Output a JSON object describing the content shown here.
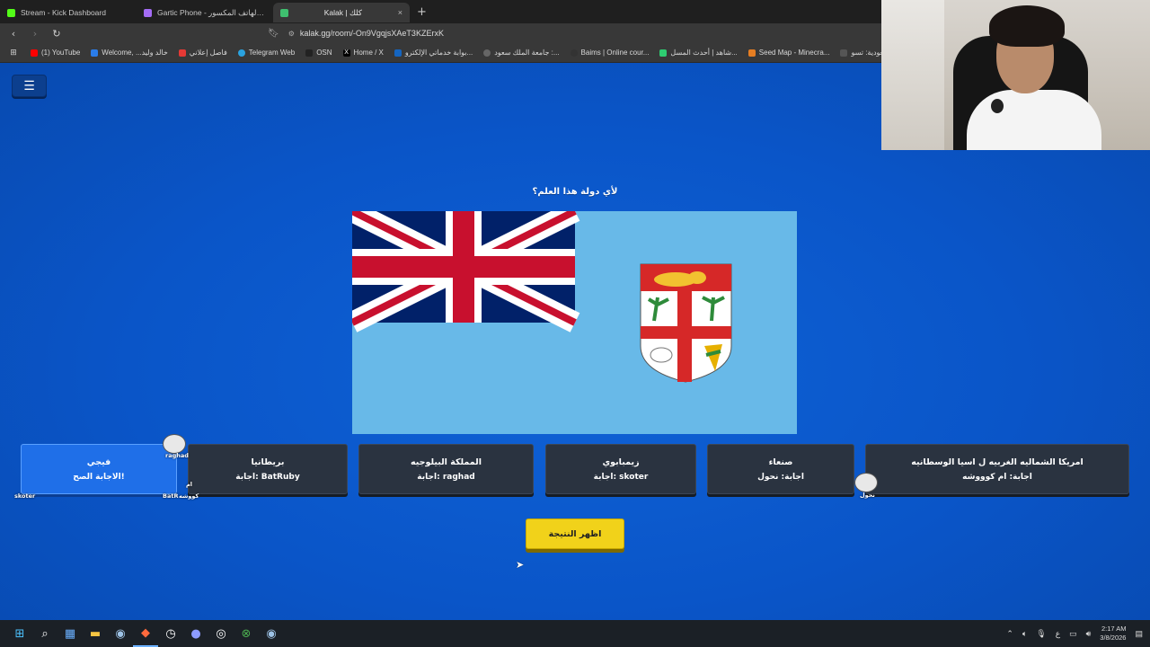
{
  "browser": {
    "tabs": [
      {
        "title": "Stream - Kick Dashboard",
        "icon": "kick-icon",
        "color": "#53fc18",
        "active": false
      },
      {
        "title": "Gartic Phone - لعبة الهاتف المكسور",
        "icon": "gartic-icon",
        "color": "#a46cf5",
        "active": false
      },
      {
        "title": "Kalak | كلك",
        "icon": "kalak-icon",
        "color": "#3fbf6f",
        "active": true
      }
    ],
    "new_tab": "+",
    "tab_close": "×",
    "url": "kalak.gg/room/-On9VgqjsXAeT3KZErxK",
    "bookmarks": [
      {
        "label": "(1) YouTube",
        "color": "#ff0000"
      },
      {
        "label": "Welcome, ...خالد وليد",
        "color": "#2b7de9"
      },
      {
        "label": "فاصل إعلاني",
        "color": "#e53935"
      },
      {
        "label": "Telegram Web",
        "color": "#2aa3e0"
      },
      {
        "label": "OSN",
        "color": "#222222"
      },
      {
        "label": "Home / X",
        "color": "#000000"
      },
      {
        "label": "بوابة خدماتي الإلكترو...",
        "color": "#1565c0"
      },
      {
        "label": "جامعة الملك سعود :...",
        "color": "#666666"
      },
      {
        "label": "Baims | Online cour...",
        "color": "#333333"
      },
      {
        "label": "شاهد | أحدث المسل...",
        "color": "#2ecc71"
      },
      {
        "label": "Seed Map - Minecra...",
        "color": "#e67e22"
      },
      {
        "label": "السعودية: تسو...",
        "color": "#555555"
      }
    ]
  },
  "game": {
    "question": "لأي دولة هذا العلم؟",
    "flag_name": "Fiji",
    "answers": [
      {
        "title": "فيجي",
        "sub": "الاجابة الصح!",
        "correct": true
      },
      {
        "title": "بريطانيا",
        "sub": "اجابة: BatRuby",
        "correct": false
      },
      {
        "title": "المملكة البيلوجيه",
        "sub": "اجابة: raghad",
        "correct": false
      },
      {
        "title": "زيمبابوي",
        "sub": "اجابة: skoter",
        "correct": false
      },
      {
        "title": "صنعاء",
        "sub": "اجابة: نحول",
        "correct": false
      },
      {
        "title": "امريكا الشماليه الغربيه ل اسيا الوسطانيه",
        "sub": "اجابة: ام كوووشه",
        "correct": false
      }
    ],
    "players": {
      "raghad": "raghad",
      "skoter": "skoter",
      "batruby": "BatR",
      "umm": "ام",
      "umm2": "كووشه",
      "nahool": "نحول"
    },
    "reveal_button": "اظهر النتيجة",
    "menu_icon": "☰"
  },
  "taskbar": {
    "time": "2:17 AM",
    "date": "3/8/2026",
    "lang": "ع"
  }
}
